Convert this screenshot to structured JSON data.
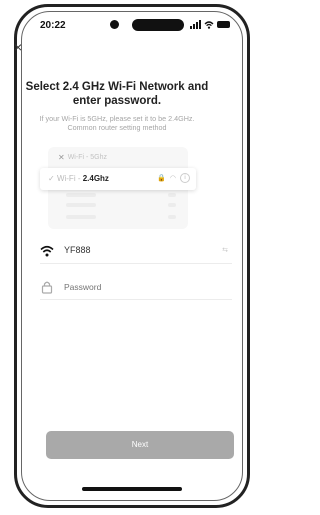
{
  "status_bar": {
    "time": "20:22"
  },
  "header": {
    "close_symbol": "×"
  },
  "main": {
    "title": "Select 2.4 GHz Wi-Fi Network and enter password.",
    "subtitle_line1": "If your Wi-Fi is 5GHz, please set it to be 2.4GHz.",
    "subtitle_line2": "Common router setting method"
  },
  "illustration": {
    "row_5ghz": "Wi-Fi - 5Ghz",
    "row_24_prefix": "Wi-Fi - ",
    "row_24_bold": "2.4Ghz"
  },
  "form": {
    "wifi_name": "YF888",
    "switch_label": "⇆",
    "password_placeholder": "Password"
  },
  "actions": {
    "next_label": "Next"
  },
  "colors": {
    "next_button_bg": "#a9a9a9",
    "title_text": "#222222",
    "hint_text": "#a6a6a6"
  }
}
